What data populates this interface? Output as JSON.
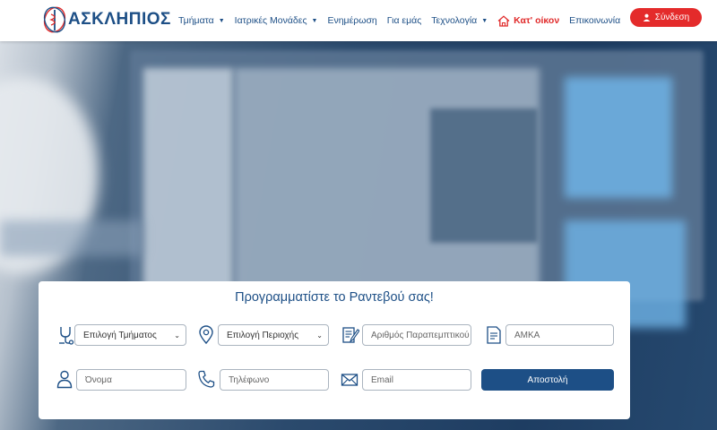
{
  "header": {
    "logo_text": "ΑΣΚΛΗΠΙΟΣ",
    "nav": [
      {
        "label": "Τμήματα",
        "has_dropdown": true
      },
      {
        "label": "Ιατρικές Μονάδες",
        "has_dropdown": true
      },
      {
        "label": "Ενημέρωση",
        "has_dropdown": false
      },
      {
        "label": "Για εμάς",
        "has_dropdown": false
      },
      {
        "label": "Τεχνολογία",
        "has_dropdown": true
      },
      {
        "label": "Κατ' οίκον",
        "has_dropdown": false,
        "icon": "home-icon"
      },
      {
        "label": "Επικοινωνία",
        "has_dropdown": false
      }
    ],
    "login_label": "Σύνδεση",
    "colors": {
      "brand": "#1d4f86",
      "accent": "#e42b2b"
    }
  },
  "form": {
    "title": "Προγραμματίστε το Ραντεβού σας!",
    "department_select": "Επιλογή Τμήματος",
    "region_select": "Επιλογή Περιοχής",
    "referral_placeholder": "Αριθμός Παραπεμπτικού",
    "amka_placeholder": "ΑΜΚΑ",
    "name_placeholder": "Όνομα",
    "phone_placeholder": "Τηλέφωνο",
    "email_placeholder": "Email",
    "submit_label": "Αποστολή"
  }
}
